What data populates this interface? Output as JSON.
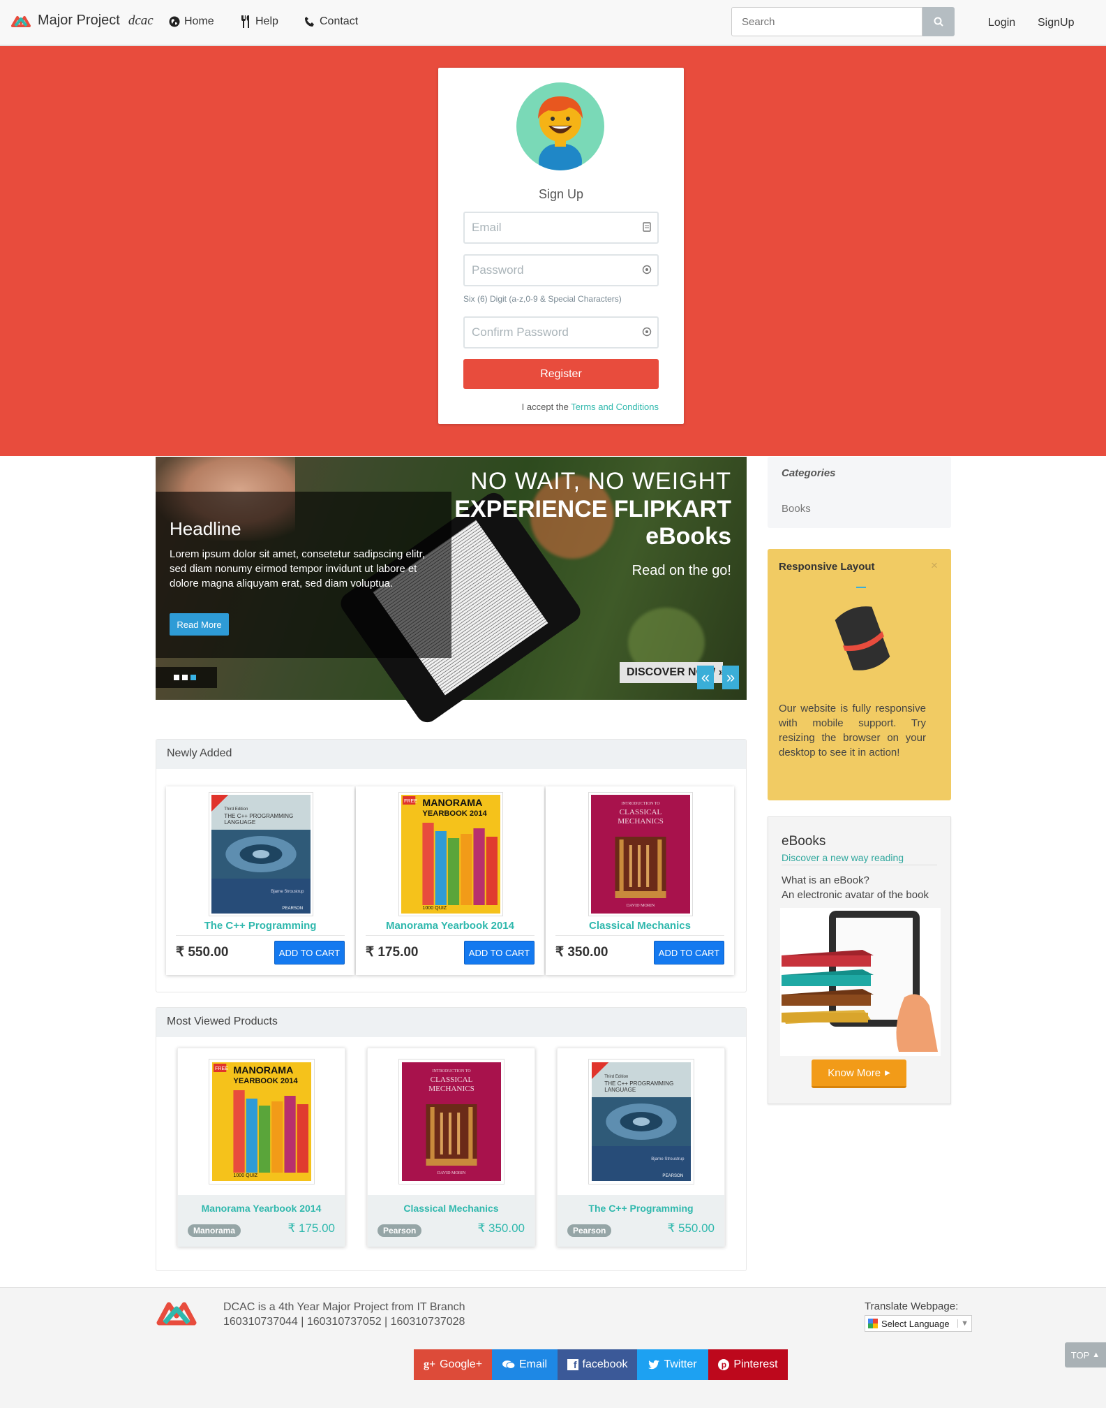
{
  "navbar": {
    "brand": "Major Project",
    "brand_suffix": "dcac",
    "links": [
      "Home",
      "Help",
      "Contact"
    ],
    "search_placeholder": "Search",
    "login": "Login",
    "signup": "SignUp"
  },
  "signup_form": {
    "title": "Sign Up",
    "email_placeholder": "Email",
    "password_placeholder": "Password",
    "password_hint": "Six (6) Digit (a-z,0-9 & Special Characters)",
    "confirm_placeholder": "Confirm Password",
    "register_label": "Register",
    "terms_prefix": "I accept the",
    "terms_link": "Terms and Conditions"
  },
  "carousel": {
    "headline": "Headline",
    "text": "Lorem ipsum dolor sit amet, consetetur sadipscing elitr, sed diam nonumy eirmod tempor invidunt ut labore et dolore magna aliquyam erat, sed diam voluptua.",
    "read_more": "Read More",
    "ad_line1": "NO WAIT, NO WEIGHT",
    "ad_line2": "EXPERIENCE FLIPKART eBooks",
    "ad_line3": "Read on the go!",
    "ad_button": "DISCOVER NOW »",
    "active_slide": 3,
    "slide_count": 3
  },
  "categories": {
    "title": "Categories",
    "items": [
      "Books"
    ]
  },
  "responsive_panel": {
    "title": "Responsive Layout",
    "close": "×",
    "text": "Our website is fully responsive with mobile support. Try resizing the browser on your desktop to see it in action!"
  },
  "ebooks_panel": {
    "title": "eBooks",
    "subtitle": "Discover a new way reading",
    "question": "What is an eBook?",
    "answer": "An electronic avatar of the book",
    "button": "Know More"
  },
  "newly_added": {
    "title": "Newly Added",
    "products": [
      {
        "name": "The C++ Programming",
        "price": "₹ 550.00",
        "cart": "ADD TO CART",
        "cover": "cpp"
      },
      {
        "name": "Manorama Yearbook 2014",
        "price": "₹ 175.00",
        "cart": "ADD TO CART",
        "cover": "manorama"
      },
      {
        "name": "Classical Mechanics",
        "price": "₹ 350.00",
        "cart": "ADD TO CART",
        "cover": "mechanics"
      }
    ]
  },
  "most_viewed": {
    "title": "Most Viewed Products",
    "products": [
      {
        "name": "Manorama Yearbook 2014",
        "publisher": "Manorama",
        "price": "₹ 175.00",
        "cover": "manorama"
      },
      {
        "name": "Classical Mechanics",
        "publisher": "Pearson",
        "price": "₹ 350.00",
        "cover": "mechanics"
      },
      {
        "name": "The C++ Programming",
        "publisher": "Pearson",
        "price": "₹ 550.00",
        "cover": "cpp"
      }
    ]
  },
  "covers": {
    "cpp": {
      "edition": "Third Edition",
      "title": "THE C++ PROGRAMMING LANGUAGE",
      "author": "Bjarne Stroustrup",
      "publisher": "PEARSON"
    },
    "manorama": {
      "title1": "MANORAMA",
      "title2": "YEARBOOK 2014",
      "badge": "FREE",
      "bottom": "1000 QUIZ"
    },
    "mechanics": {
      "intro": "INTRODUCTION TO",
      "title1": "CLASSICAL",
      "title2": "MECHANICS",
      "author": "DAVID MORIN"
    }
  },
  "footer": {
    "line1": "DCAC is a 4th Year Major Project from IT Branch",
    "line2": "160310737044 | 160310737052 | 160310737028",
    "translate_label": "Translate Webpage:",
    "language_select": "Select Language",
    "share": [
      "Google+",
      "Email",
      "facebook",
      "Twitter",
      "Pinterest"
    ],
    "top": "TOP"
  },
  "colors": {
    "hero": "#e84c3d",
    "accent": "#2fb8ad",
    "cart": "#1479ef",
    "google": "#dd4b39",
    "email": "#1e88e5",
    "facebook": "#3b5998",
    "twitter": "#1da1f2",
    "pinterest": "#bd081c"
  }
}
